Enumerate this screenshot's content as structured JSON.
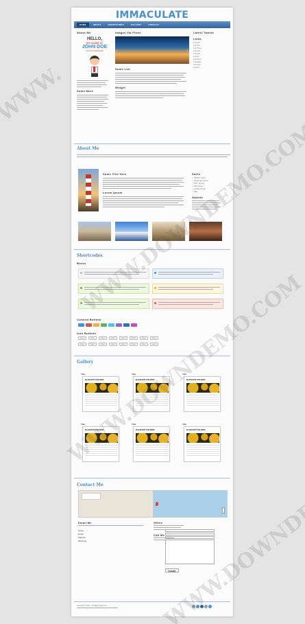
{
  "site": {
    "logo": "IMMACULATE"
  },
  "nav": {
    "items": [
      "Home",
      "About",
      "Shortcodes",
      "Gallery",
      "Contact"
    ]
  },
  "sidebar_left": {
    "about_heading": "About Me",
    "hello_line1": "HELLO,",
    "hello_line2": "MY NAME IS",
    "name": "JOHN DOE",
    "role": "GRAPHIC DESIGNER",
    "more_heading": "Some More"
  },
  "center": {
    "images_heading": "Images Via Flickr",
    "list_heading": "Some List",
    "widget_heading": "Widget"
  },
  "sidebar_right": {
    "tweets_heading": "Latest Tweets",
    "links_heading": "Links",
    "links": [
      "Link One",
      "Link Two",
      "Link Three",
      "Link Four",
      "Link Five",
      "Link Six",
      "Link Seven",
      "Link Eight",
      "Link Nine",
      "Link Ten"
    ]
  },
  "about": {
    "heading": "About Me",
    "title_here": "Some Title Here",
    "lorem_heading": "Lorem Ipsum",
    "skills_heading": "Skills",
    "skills": [
      "HTML5 / CSS3",
      "JavaScript / jQuery",
      "PHP / MySQL",
      "Web Design",
      "Graphic Design",
      "SEO"
    ],
    "awards_heading": "Awards"
  },
  "shortcodes": {
    "heading": "Shortcodes",
    "boxes_heading": "Boxes",
    "colored_buttons_heading": "Colored Buttons",
    "icon_buttons_heading": "Icon Buttons",
    "colored_buttons": [
      "#4a8fd1",
      "#d9534f",
      "#f0ad4e",
      "#5cb85c",
      "#5bc0de",
      "#8a6ad1",
      "#3a6fb0",
      "#c04dc4"
    ],
    "icon_button_label": "Button"
  },
  "gallery": {
    "heading": "Gallery",
    "card_label": "Title",
    "card_title": "ELEGANT FOLDER"
  },
  "contact": {
    "heading": "Contact Me",
    "email_heading": "Email Me",
    "name_label": "Name",
    "email_label": "Email",
    "website_label": "Website",
    "message_label": "Message",
    "submit_label": "SUBMIT",
    "office_heading": "Office",
    "call_heading": "Call Me"
  },
  "footer": {
    "copyright": "Copyright © 2013 - All Rights Reserved"
  },
  "colors": {
    "accent": "#4a90d0",
    "nav_dark": "#33649d",
    "page_bg": "#e4e4e4"
  }
}
